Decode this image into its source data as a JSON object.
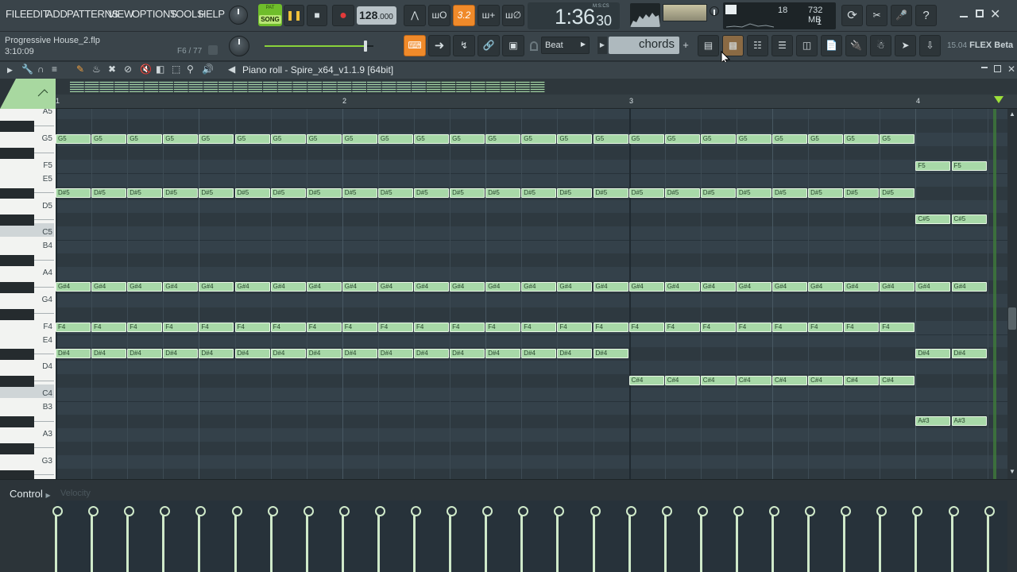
{
  "menu": [
    "FILE",
    "EDIT",
    "ADD",
    "PATTERNS",
    "VIEW",
    "OPTIONS",
    "TOOLS",
    "HELP"
  ],
  "transport": {
    "pat_label": "PAT",
    "song_label": "SONG",
    "tempo_int": "128",
    "tempo_dec": ".000"
  },
  "time": {
    "main": "1:36",
    "sub": "30",
    "unit": "M:S:CS"
  },
  "stats": {
    "cpu": "18",
    "memory": "732 MB",
    "polyphony": "1"
  },
  "project": {
    "name": "Progressive House_2.flp",
    "time": "3:10:09",
    "position": "F6 / 77"
  },
  "master_level": 0.93,
  "snap": {
    "value": "Beat"
  },
  "scale_dropdown": {
    "value": "chords"
  },
  "version": {
    "number": "15.04",
    "label": "FLEX Beta"
  },
  "piano_roll": {
    "title": "Piano roll - Spire_x64_v1.1.9 [64bit]",
    "bars": [
      "1",
      "2",
      "3",
      "4"
    ],
    "keys": [
      "A5",
      "G5",
      "F5",
      "E5",
      "D5",
      "C5",
      "B4",
      "A4",
      "G4",
      "F4",
      "E4",
      "D4",
      "C4",
      "B3",
      "A3",
      "G3"
    ],
    "notes": [
      {
        "pitch": "G5",
        "label": "G5",
        "start": 0,
        "length": 24
      },
      {
        "pitch": "D#5",
        "label": "D#5",
        "start": 0,
        "length": 24
      },
      {
        "pitch": "G#4",
        "label": "G#4",
        "start": 0,
        "length": 26
      },
      {
        "pitch": "F4",
        "label": "F4",
        "start": 0,
        "length": 24
      },
      {
        "pitch": "D#4",
        "label": "D#4",
        "start": 0,
        "length": 16
      },
      {
        "pitch": "C#4",
        "label": "C#4",
        "start": 16,
        "length": 8
      },
      {
        "pitch": "F5",
        "label": "F5",
        "start": 24,
        "length": 2
      },
      {
        "pitch": "C#5",
        "label": "C#5",
        "start": 24,
        "length": 2
      },
      {
        "pitch": "D#4",
        "label": "D#4",
        "start": 24,
        "length": 2
      },
      {
        "pitch": "A#3",
        "label": "A#3",
        "start": 24,
        "length": 2
      }
    ]
  },
  "control": {
    "label": "Control",
    "sub": "Velocity",
    "velocity": 0.93
  },
  "colors": {
    "accent_orange": "#f08a2a",
    "note_fill": "#a8d9a8",
    "song_green": "#6fbd2b",
    "grid_bg": "#34414a"
  },
  "icons": [
    "pitch-knob-icon",
    "play-pause-icon",
    "stop-icon",
    "record-icon",
    "metronome-icon",
    "pattern-icon",
    "typing-keyboard-icon",
    "step-sequencer-icon",
    "mixer-icon",
    "playlist-icon",
    "browser-icon",
    "plugin-icon",
    "help-icon",
    "pencil-icon",
    "paint-icon",
    "magnet-icon",
    "delete-icon",
    "mute-icon",
    "slice-icon",
    "select-icon",
    "zoom-icon",
    "speaker-icon"
  ]
}
